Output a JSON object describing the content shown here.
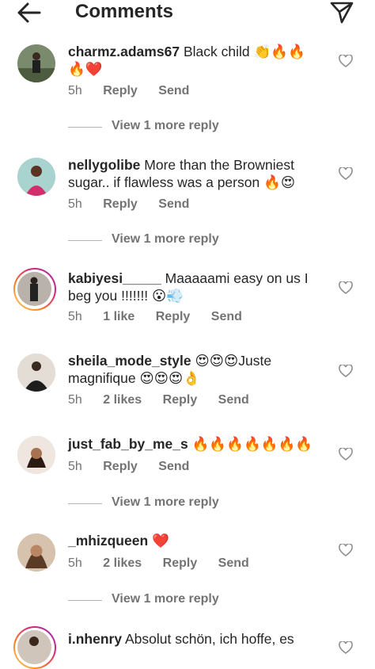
{
  "header": {
    "title": "Comments",
    "back_icon": "arrow-left-icon",
    "send_icon": "paper-plane-icon"
  },
  "colors": {
    "text": "#262626",
    "meta": "#737373",
    "heart_red": "#ed4956",
    "fire": "#f05a24"
  },
  "comments": [
    {
      "username": "charmz.adams67",
      "text": "Black child 👏🔥🔥🔥❤️",
      "time": "5h",
      "likes": "",
      "reply_label": "Reply",
      "send_label": "Send",
      "view_more": "View 1 more reply"
    },
    {
      "username": "nellygolibe",
      "text": "More than the Browniest sugar.. if flawless was a person 🔥😍",
      "time": "5h",
      "likes": "",
      "reply_label": "Reply",
      "send_label": "Send",
      "view_more": "View 1 more reply"
    },
    {
      "username": "kabiyesi_____",
      "text": "Maaaaami easy on us I beg you !!!!!!! 😮💨",
      "time": "5h",
      "likes": "1 like",
      "reply_label": "Reply",
      "send_label": "Send",
      "view_more": ""
    },
    {
      "username": "sheila_mode_style",
      "text": "😍😍😍Juste magnifique 😍😍😍👌",
      "time": "5h",
      "likes": "2 likes",
      "reply_label": "Reply",
      "send_label": "Send",
      "view_more": ""
    },
    {
      "username": "just_fab_by_me_s",
      "text": "🔥🔥🔥🔥🔥🔥🔥",
      "time": "5h",
      "likes": "",
      "reply_label": "Reply",
      "send_label": "Send",
      "view_more": "View 1 more reply"
    },
    {
      "username": "_mhizqueen",
      "text": "❤️",
      "time": "5h",
      "likes": "2 likes",
      "reply_label": "Reply",
      "send_label": "Send",
      "view_more": "View 1 more reply"
    },
    {
      "username": "i.nhenry",
      "text": "Absolut schön, ich hoffe, es",
      "time": "",
      "likes": "",
      "reply_label": "",
      "send_label": "",
      "view_more": ""
    }
  ]
}
